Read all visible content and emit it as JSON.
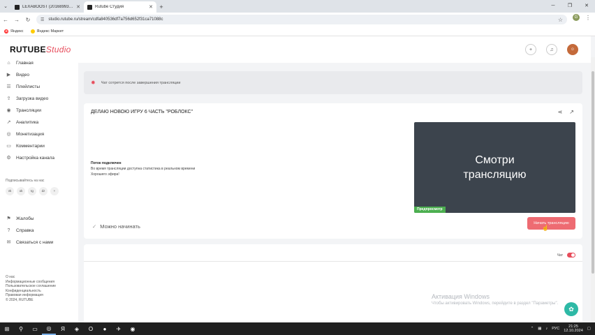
{
  "browser": {
    "tabs": [
      {
        "title": "LEXABOOST (20168993) - смот"
      },
      {
        "title": "Rutube Студия"
      }
    ],
    "new_tab": "+",
    "url": "studio.rutube.ru/stream/cdfa840536df7a756d652f31ca71088c",
    "bookmarks": [
      {
        "label": "Яндекс"
      },
      {
        "label": "Яндекс Маркет"
      }
    ]
  },
  "header": {
    "logo_main": "RUTUBE",
    "logo_studio": "Studio"
  },
  "sidebar": {
    "items": [
      {
        "label": "Главная"
      },
      {
        "label": "Видео"
      },
      {
        "label": "Плейлисты"
      },
      {
        "label": "Загрузка видео"
      },
      {
        "label": "Трансляции"
      },
      {
        "label": "Аналитика"
      },
      {
        "label": "Монетизация"
      },
      {
        "label": "Комментарии"
      },
      {
        "label": "Настройка канала"
      }
    ],
    "follow_label": "Подписывайтесь на нас",
    "socials": [
      "vk",
      "ok",
      "tg",
      "dz",
      "+"
    ],
    "bottom_items": [
      {
        "label": "Жалобы"
      },
      {
        "label": "Справка"
      },
      {
        "label": "Связаться с нами"
      }
    ],
    "footer_links": [
      "О нас",
      "Информационные сообщения",
      "Пользовательское соглашение",
      "Конфиденциальность",
      "Правовая информация",
      "© 2024, RUTUBE"
    ]
  },
  "alert": {
    "text": "Чат сотрется после завершения трансляции"
  },
  "stream": {
    "title": "ДЕЛАЮ НОВОЮ ИГРУ 6 ЧАСТЬ \"РОБЛОКС\"",
    "status_title": "Поток подключен",
    "status_line1": "Во время трансляции доступна статистика в реальном времени",
    "status_line2": "Хорошего эфира!",
    "ready_label": "Можно начинать",
    "preview_line1": "Смотри",
    "preview_line2": "трансляцию",
    "preview_badge": "Предпросмотр",
    "start_button": "Начать трансляцию"
  },
  "chat": {
    "label": "Чат",
    "enabled": true
  },
  "watermark": {
    "title": "Активация Windows",
    "subtitle": "Чтобы активировать Windows, перейдите в раздел \"Параметры\"."
  },
  "taskbar": {
    "lang": "РУС",
    "time": "21:25",
    "date": "12.10.2024"
  },
  "colors": {
    "accent": "#e74c5b",
    "start_button": "#ee6b72",
    "preview_badge": "#4caf50",
    "fab": "#2eb9a6"
  }
}
